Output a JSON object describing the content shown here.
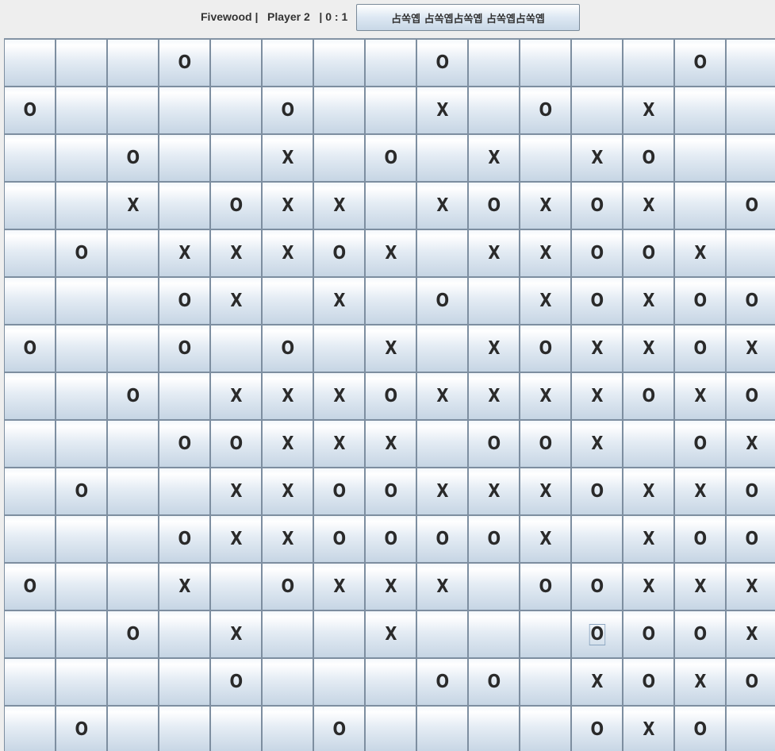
{
  "status": {
    "text": "Fivewood |   Player 2   | 0 : 1"
  },
  "reset_button": {
    "label": "占쏙옙 占쏙옙占쏙옙 占쏙옙占쏙옙"
  },
  "board": {
    "rows": [
      [
        "",
        "",
        "",
        "O",
        "",
        "",
        "",
        "",
        "O",
        "",
        "",
        "",
        "",
        "O",
        ""
      ],
      [
        "O",
        "",
        "",
        "",
        "",
        "O",
        "",
        "",
        "X",
        "",
        "O",
        "",
        "X",
        "",
        ""
      ],
      [
        "",
        "",
        "O",
        "",
        "",
        "X",
        "",
        "O",
        "",
        "X",
        "",
        "X",
        "O",
        "",
        ""
      ],
      [
        "",
        "",
        "X",
        "",
        "O",
        "X",
        "X",
        "",
        "X",
        "O",
        "X",
        "O",
        "X",
        "",
        "O"
      ],
      [
        "",
        "O",
        "",
        "X",
        "X",
        "X",
        "O",
        "X",
        "",
        "X",
        "X",
        "O",
        "O",
        "X",
        ""
      ],
      [
        "",
        "",
        "",
        "O",
        "X",
        "",
        "X",
        "",
        "O",
        "",
        "X",
        "O",
        "X",
        "O",
        "O"
      ],
      [
        "O",
        "",
        "",
        "O",
        "",
        "O",
        "",
        "X",
        "",
        "X",
        "O",
        "X",
        "X",
        "O",
        "X"
      ],
      [
        "",
        "",
        "O",
        "",
        "X",
        "X",
        "X",
        "O",
        "X",
        "X",
        "X",
        "X",
        "O",
        "X",
        "O"
      ],
      [
        "",
        "",
        "",
        "O",
        "O",
        "X",
        "X",
        "X",
        "",
        "O",
        "O",
        "X",
        "",
        "O",
        "X"
      ],
      [
        "",
        "O",
        "",
        "",
        "X",
        "X",
        "O",
        "O",
        "X",
        "X",
        "X",
        "O",
        "X",
        "X",
        "O"
      ],
      [
        "",
        "",
        "",
        "O",
        "X",
        "X",
        "O",
        "O",
        "O",
        "O",
        "X",
        "",
        "X",
        "O",
        "O"
      ],
      [
        "O",
        "",
        "",
        "X",
        "",
        "O",
        "X",
        "X",
        "X",
        "",
        "O",
        "O",
        "X",
        "X",
        "X"
      ],
      [
        "",
        "",
        "O",
        "",
        "X",
        "",
        "",
        "X",
        "",
        "",
        "",
        "O",
        "O",
        "O",
        "X"
      ],
      [
        "",
        "",
        "",
        "",
        "O",
        "",
        "",
        "",
        "O",
        "O",
        "",
        "X",
        "O",
        "X",
        "O"
      ],
      [
        "",
        "O",
        "",
        "",
        "",
        "",
        "O",
        "",
        "",
        "",
        "",
        "O",
        "X",
        "O",
        ""
      ]
    ],
    "focused_cell": [
      12,
      11
    ]
  },
  "colors": {
    "background": "#eeeeee",
    "cell_border": "#7d8ea0",
    "mark": "#2a2a2a"
  }
}
